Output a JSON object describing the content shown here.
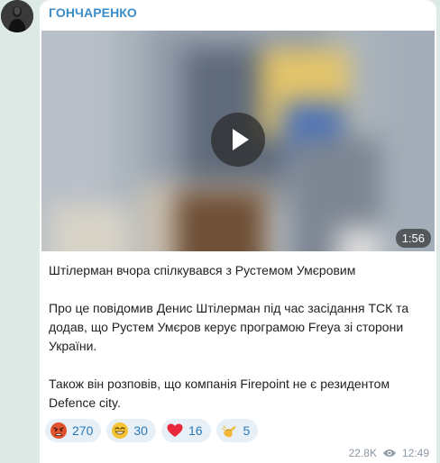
{
  "channel": {
    "name": "ГОНЧАРЕНКО",
    "avatar_icon": "person-avatar"
  },
  "video": {
    "duration": "1:56",
    "play_icon": "play-icon"
  },
  "message": {
    "paragraphs": [
      "Штілерман вчора спілкувався з Рустемом Умєровим",
      "Про це повідомив Денис Штілерман під час засідання ТСК та додав, що Рустем Умєров керує програмою Freya зі сторони України.",
      "Також він розповів, що компанія Firepoint не є резидентом Defence city."
    ]
  },
  "reactions": [
    {
      "icon": "angry-face-icon",
      "count": "270"
    },
    {
      "icon": "grinning-face-icon",
      "count": "30"
    },
    {
      "icon": "red-heart-icon",
      "count": "16"
    },
    {
      "icon": "clapping-hands-icon",
      "count": "5"
    }
  ],
  "meta": {
    "views": "22.8K",
    "views_icon": "eye-icon",
    "time": "12:49"
  },
  "colors": {
    "background": "#dde9e4",
    "channel_name": "#3a8cc9",
    "reaction_bg": "#e7f0f7",
    "reaction_text": "#2a79b8",
    "meta_text": "#8c98a3"
  }
}
